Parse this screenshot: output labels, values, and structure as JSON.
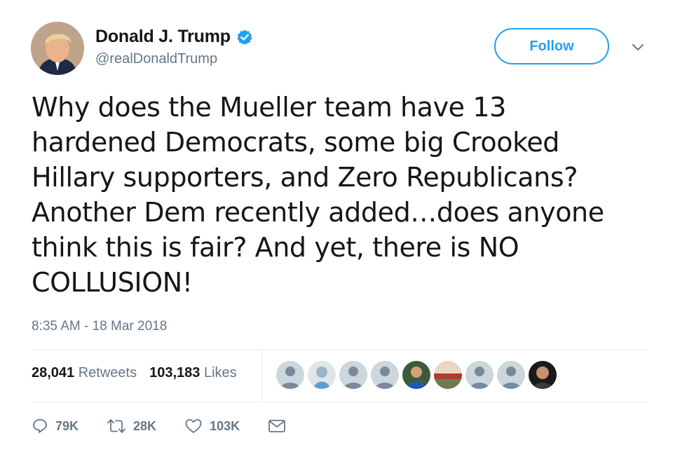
{
  "author": {
    "display_name": "Donald J. Trump",
    "handle": "@realDonaldTrump",
    "verified": true
  },
  "follow_button": {
    "label": "Follow"
  },
  "tweet": {
    "text": "Why does the Mueller team have 13\nhardened Democrats, some big Crooked\nHillary supporters, and Zero Republicans?\nAnother Dem recently added…does anyone\nthink this is fair? And yet, there is NO\nCOLLUSION!",
    "timestamp": "8:35 AM - 18 Mar 2018"
  },
  "stats": {
    "retweets_count": "28,041",
    "retweets_label": "Retweets",
    "likes_count": "103,183",
    "likes_label": "Likes"
  },
  "actions": {
    "replies": "79K",
    "retweets": "28K",
    "likes": "103K"
  },
  "colors": {
    "accent": "#1da1f2",
    "muted": "#657786",
    "text": "#14171a",
    "divider": "#e6ecf0"
  },
  "icons": [
    "verified-badge-icon",
    "chevron-down-icon",
    "reply-icon",
    "retweet-icon",
    "heart-icon",
    "message-icon"
  ]
}
